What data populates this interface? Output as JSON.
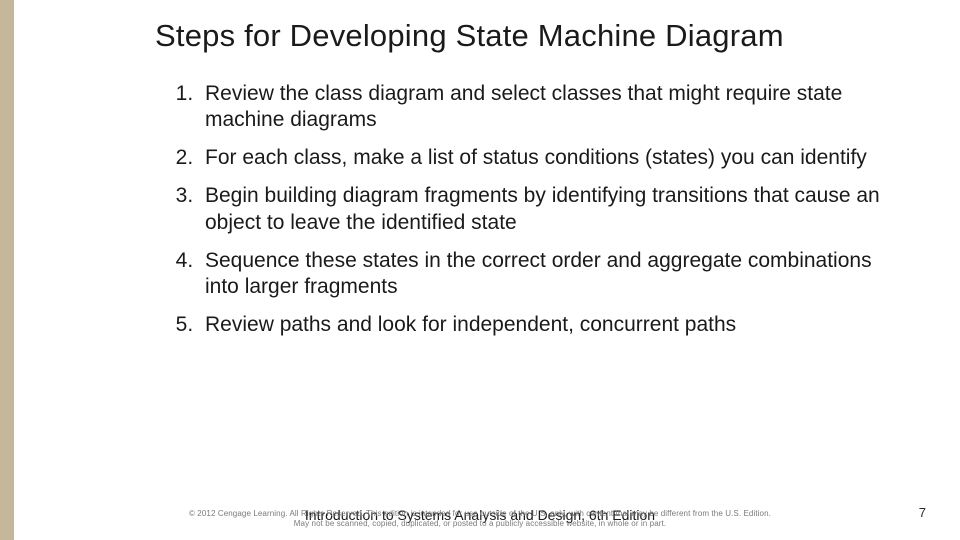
{
  "title": "Steps for Developing State Machine Diagram",
  "steps": [
    "Review the class diagram and select classes that might require state machine diagrams",
    "For each class, make a list of status conditions (states) you can identify",
    "Begin building diagram fragments by identifying transitions that cause an object to leave the identified state",
    "Sequence these states in the correct order and aggregate combinations into larger fragments",
    "Review paths and look for independent, concurrent paths"
  ],
  "footer": {
    "book_title": "Introduction to Systems Analysis and Design, 6th Edition",
    "copyright_line1": "© 2012 Cengage Learning. All Rights Reserved. This edition is intended for use outside of the U.S. only, with content that may be different from the U.S. Edition.",
    "copyright_line2": "May not be scanned, copied, duplicated, or posted to a publicly accessible website, in whole or in part."
  },
  "page_number": "7"
}
